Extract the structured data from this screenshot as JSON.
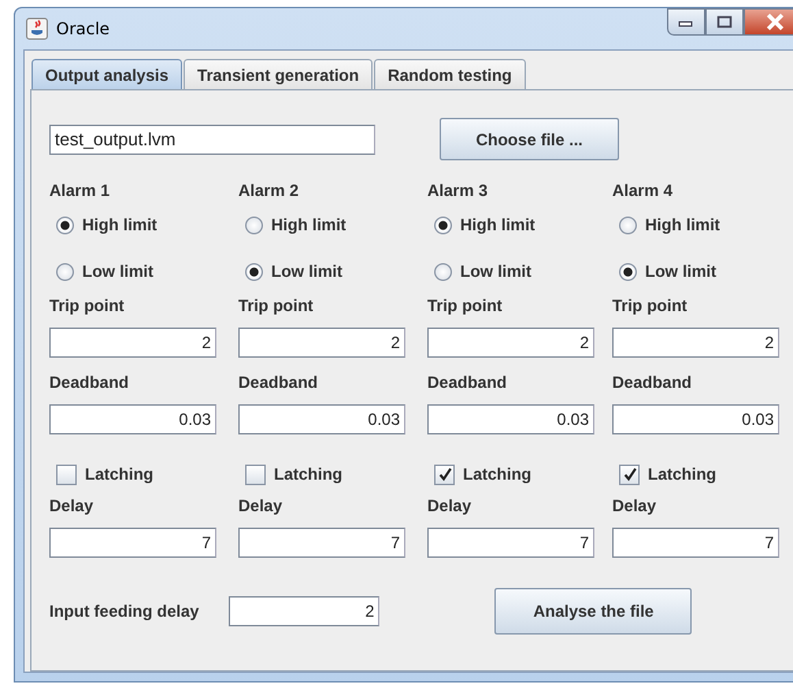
{
  "window": {
    "title": "Oracle"
  },
  "tabs": [
    {
      "label": "Output analysis",
      "selected": true
    },
    {
      "label": "Transient generation",
      "selected": false
    },
    {
      "label": "Random testing",
      "selected": false
    }
  ],
  "file_field": {
    "value": "test_output.lvm"
  },
  "choose_button": "Choose file ...",
  "alarms": [
    {
      "title": "Alarm 1",
      "limits": [
        {
          "label": "High limit",
          "selected": true
        },
        {
          "label": "Low limit",
          "selected": false
        }
      ],
      "trip_label": "Trip point",
      "trip_value": "2",
      "deadband_label": "Deadband",
      "deadband_value": "0.03",
      "latching": {
        "label": "Latching",
        "checked": false
      },
      "delay_label": "Delay",
      "delay_value": "7"
    },
    {
      "title": "Alarm 2",
      "limits": [
        {
          "label": "High limit",
          "selected": false
        },
        {
          "label": "Low limit",
          "selected": true
        }
      ],
      "trip_label": "Trip point",
      "trip_value": "2",
      "deadband_label": "Deadband",
      "deadband_value": "0.03",
      "latching": {
        "label": "Latching",
        "checked": false
      },
      "delay_label": "Delay",
      "delay_value": "7"
    },
    {
      "title": "Alarm 3",
      "limits": [
        {
          "label": "High limit",
          "selected": true
        },
        {
          "label": "Low limit",
          "selected": false
        }
      ],
      "trip_label": "Trip point",
      "trip_value": "2",
      "deadband_label": "Deadband",
      "deadband_value": "0.03",
      "latching": {
        "label": "Latching",
        "checked": true
      },
      "delay_label": "Delay",
      "delay_value": "7"
    },
    {
      "title": "Alarm 4",
      "limits": [
        {
          "label": "High limit",
          "selected": false
        },
        {
          "label": "Low limit",
          "selected": true
        }
      ],
      "trip_label": "Trip point",
      "trip_value": "2",
      "deadband_label": "Deadband",
      "deadband_value": "0.03",
      "latching": {
        "label": "Latching",
        "checked": true
      },
      "delay_label": "Delay",
      "delay_value": "7"
    }
  ],
  "input_delay": {
    "label": "Input feeding delay",
    "value": "2"
  },
  "analyse_button": "Analyse the file"
}
